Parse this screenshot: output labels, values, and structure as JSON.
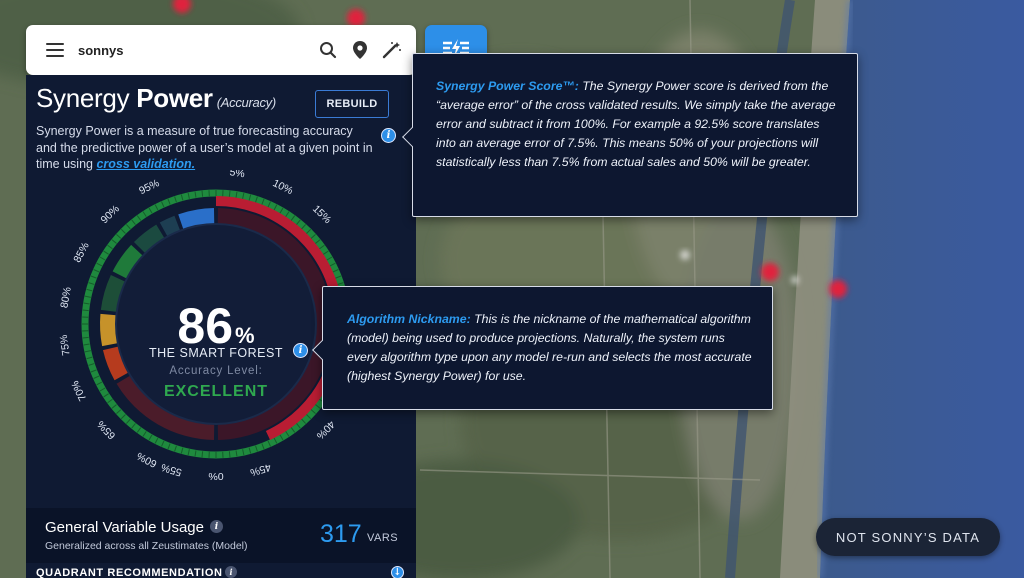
{
  "search": {
    "value": "sonnys",
    "placeholder": ""
  },
  "icons": {
    "menu": "menu-icon",
    "search": "search-icon",
    "pin": "map-pin-icon",
    "wand": "magic-wand-icon",
    "filter": "filter-bolt-icon",
    "info": "info-icon"
  },
  "panel": {
    "title_light": "Synergy ",
    "title_bold": "Power",
    "title_sub": "(Accuracy)",
    "rebuild_label": "REBUILD",
    "desc_text": "Synergy Power is a measure of true forecasting accuracy and the predictive power of a user’s model at a given point in time using ",
    "desc_link": "cross validation."
  },
  "gauge": {
    "score": "86",
    "score_unit": "%",
    "algorithm_nickname": "THE SMART FOREST",
    "accuracy_label": "Accuracy Level:",
    "accuracy_value": "EXCELLENT",
    "ticks": [
      "0%",
      "5%",
      "10%",
      "15%",
      "20%",
      "25%",
      "30%",
      "35%",
      "40%",
      "45%",
      "50%",
      "55%",
      "60%",
      "65%",
      "70%",
      "75%",
      "80%",
      "85%",
      "90%",
      "95%"
    ],
    "score_fraction": 0.86
  },
  "variables": {
    "title": "General Variable Usage",
    "subtitle": "Generalized across all Zeustimates (Model)",
    "count": "317",
    "unit": "VARS"
  },
  "quadrant": {
    "title": "QUADRANT RECOMMENDATION"
  },
  "tooltip_score": {
    "heading": "Synergy Power Score™:",
    "body": " The Synergy Power score is derived from the “average error” of the cross validated results. We simply take the average error and subtract it from 100%. For example a 92.5% score translates into an average error of 7.5%. This means 50% of your projections will statistically less than 7.5% from actual sales and 50% will be greater."
  },
  "tooltip_algo": {
    "heading": "Algorithm Nickname:",
    "body": " This is the nickname of the mathematical algorithm (model) being used to produce projections. Naturally, the system runs every algorithm type upon any model re-run and selects the most accurate (highest Synergy Power) for use."
  },
  "badge": {
    "label": "NOT SONNY’S DATA"
  },
  "colors": {
    "panel_bg": "#0f1a33",
    "accent_blue": "#2d8fe8",
    "excellent_green": "#2fa84f",
    "ring_red": "#c0223a",
    "ring_green": "#1f8a3e"
  }
}
